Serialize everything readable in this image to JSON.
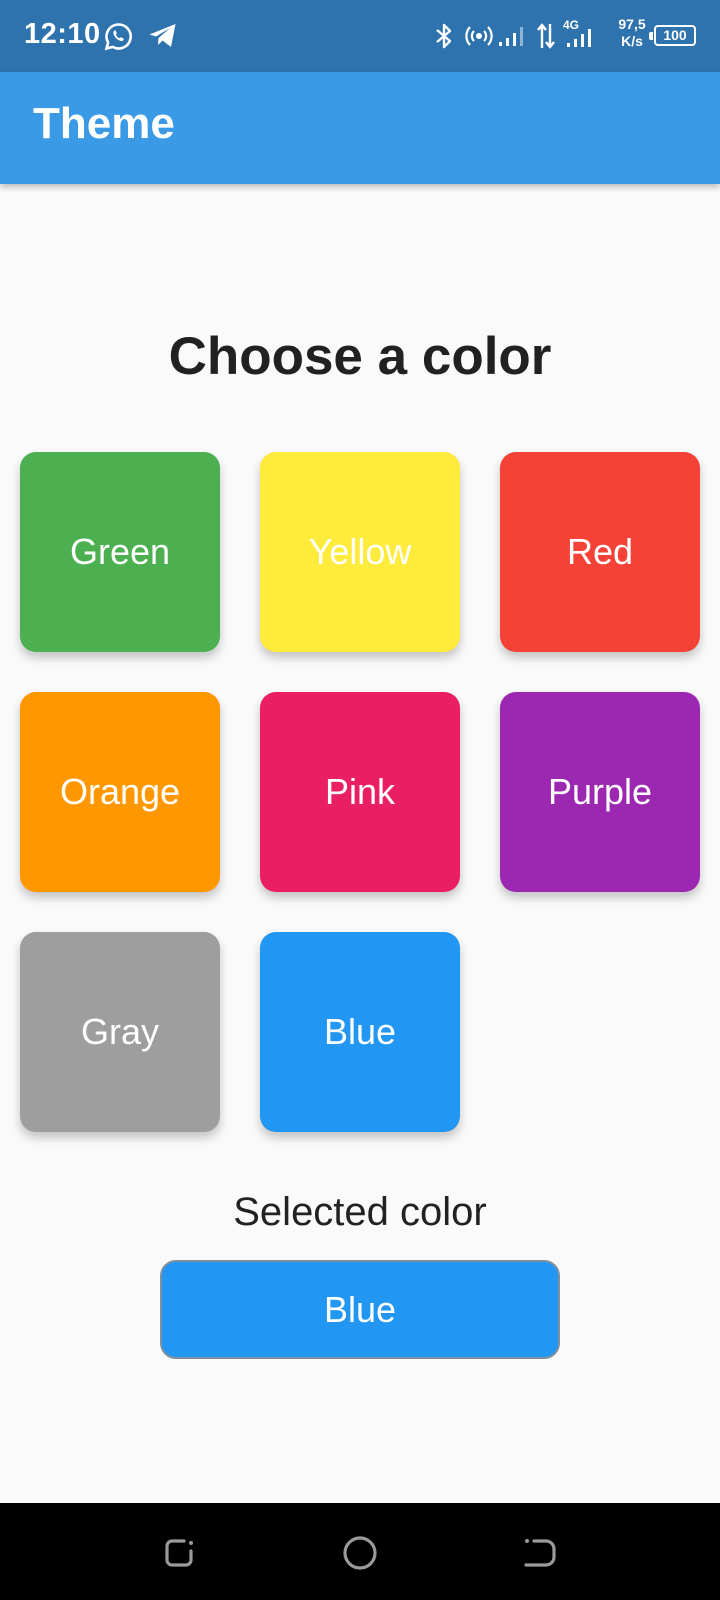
{
  "status_bar": {
    "time": "12:10",
    "speed_value": "97,5",
    "speed_unit": "K/s",
    "network_label": "4G",
    "battery": "100",
    "icons": [
      "whatsapp-icon",
      "telegram-icon",
      "bluetooth-icon",
      "hotspot-icon",
      "signal-icon",
      "data-arrows-icon",
      "signal-4g-icon",
      "battery-icon"
    ]
  },
  "app_bar": {
    "title": "Theme"
  },
  "main": {
    "heading": "Choose a color",
    "tiles": [
      {
        "label": "Green",
        "color": "#4caf50"
      },
      {
        "label": "Yellow",
        "color": "#ffeb3b"
      },
      {
        "label": "Red",
        "color": "#f44336"
      },
      {
        "label": "Orange",
        "color": "#ff9800"
      },
      {
        "label": "Pink",
        "color": "#e91e63"
      },
      {
        "label": "Purple",
        "color": "#9c27b0"
      },
      {
        "label": "Gray",
        "color": "#9e9e9e"
      },
      {
        "label": "Blue",
        "color": "#2196f3"
      }
    ],
    "selected_label": "Selected color",
    "selected": {
      "label": "Blue",
      "color": "#2196f3"
    }
  },
  "nav_bar": {
    "icons": [
      "recents-icon",
      "home-icon",
      "back-icon"
    ]
  },
  "colors": {
    "status_bar": "#2e73ae",
    "app_bar": "#3b9ae6",
    "background": "#fafafa",
    "nav_bar": "#000000"
  }
}
